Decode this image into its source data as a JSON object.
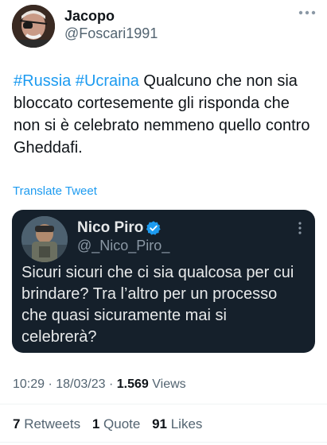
{
  "author": {
    "name": "Jacopo",
    "handle": "@Foscari1991"
  },
  "tweet": {
    "hashtag1": "#Russia",
    "hashtag2": "#Ucraina",
    "text": " Qualcuno che non sia bloccato cortesemente gli risponda che non si è celebrato nemmeno quello contro Gheddafi."
  },
  "translate_label": "Translate Tweet",
  "quoted": {
    "name": "Nico Piro",
    "handle": "@_Nico_Piro_",
    "text": "Sicuri sicuri che ci sia qualcosa per cui brindare? Tra l’altro per un processo che quasi sicuramente mai si celebrerà?"
  },
  "meta": {
    "datetime": "10:29 · 18/03/23 · ",
    "views_count": "1.569",
    "views_label": " Views"
  },
  "stats": {
    "retweets_count": "7",
    "retweets_label": "Retweets",
    "quotes_count": "1",
    "quotes_label": "Quote",
    "likes_count": "91",
    "likes_label": "Likes"
  },
  "colors": {
    "link": "#1d9bf0",
    "quote_bg": "#15202b",
    "verified": "#1d9bf0"
  },
  "icons": [
    "avatar-image",
    "more-dots-icon",
    "verified-badge-icon"
  ]
}
